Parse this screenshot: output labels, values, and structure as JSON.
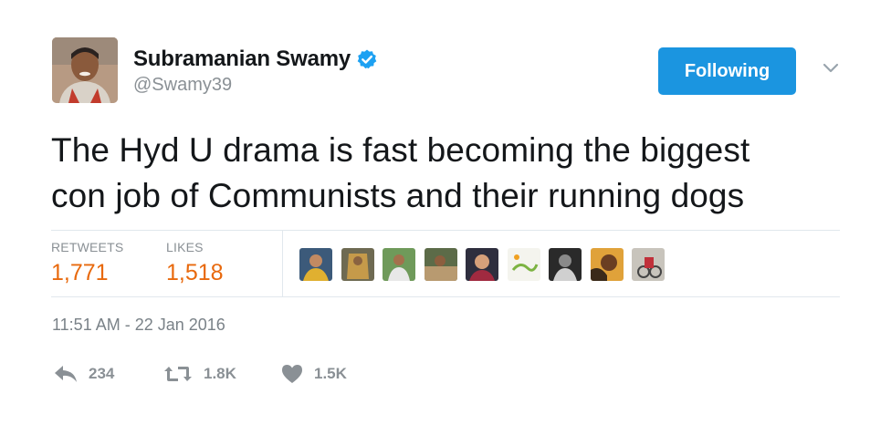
{
  "author": {
    "name": "Subramanian Swamy",
    "handle": "@Swamy39"
  },
  "follow_button": {
    "label": "Following"
  },
  "tweet": {
    "text_line1": "The Hyd U drama is fast becoming the biggest",
    "text_line2": "con job of Communists and their running dogs"
  },
  "stats": {
    "retweets_label": "RETWEETS",
    "retweets_value": "1,771",
    "likes_label": "LIKES",
    "likes_value": "1,518"
  },
  "timestamp": "11:51 AM - 22 Jan 2016",
  "actions": {
    "reply_count": "234",
    "retweet_count": "1.8K",
    "like_count": "1.5K"
  },
  "colors": {
    "accent": "#1b95e0",
    "stat_value": "#e8690d",
    "muted": "#8a9095"
  },
  "icons": [
    "verified-badge-icon",
    "chevron-down-icon",
    "reply-icon",
    "retweet-icon",
    "heart-icon"
  ]
}
